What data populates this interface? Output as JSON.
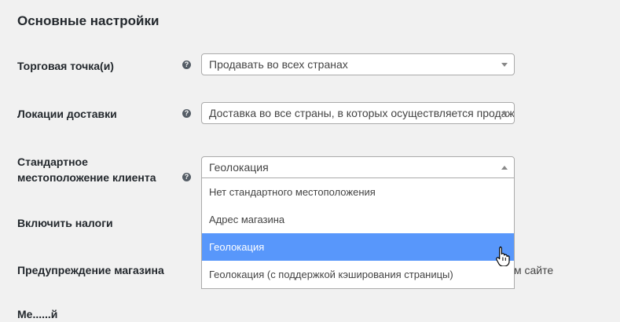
{
  "section": {
    "title": "Основные настройки"
  },
  "rows": {
    "selling_location": {
      "label": "Торговая точка(и)",
      "help": "?",
      "value": "Продавать во всех странах"
    },
    "shipping_locations": {
      "label": "Локации доставки",
      "help": "?",
      "value": "Доставка во все страны, в которых осуществляется продажа"
    },
    "default_location": {
      "label_line1": "Стандартное",
      "label_line2": "местоположение клиента",
      "help": "?",
      "value": "Геолокация",
      "options": [
        "Нет стандартного местоположения",
        "Адрес магазина",
        "Геолокация",
        "Геолокация (с поддержкой кэширования страницы)"
      ],
      "highlighted_option": 2
    },
    "enable_taxes": {
      "label": "Включить налоги"
    },
    "store_notice": {
      "label": "Предупреждение магазина",
      "trailing_text": "м сайте"
    },
    "next_row_partial": {
      "label": "Ме......й"
    }
  },
  "icons": {
    "help": "help-icon",
    "cursor": "hand-pointer-icon",
    "arrow": "chevron-down-icon"
  },
  "colors": {
    "highlight": "#5897fb",
    "background": "#f1f1f1"
  }
}
